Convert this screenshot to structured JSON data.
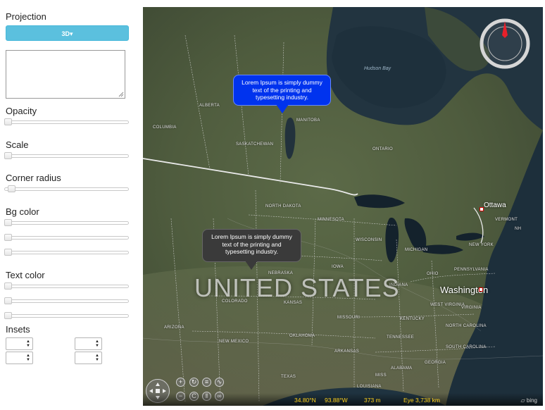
{
  "panel": {
    "projection_label": "Projection",
    "projection_value": "3D▾",
    "textarea_value": "",
    "opacity_label": "Opacity",
    "opacity_value": 0,
    "scale_label": "Scale",
    "scale_value": 0,
    "corner_radius_label": "Corner radius",
    "corner_radius_value": 0.03,
    "bg_color_label": "Bg color",
    "bg_color_values": [
      0,
      0,
      0
    ],
    "text_color_label": "Text color",
    "text_color_values": [
      0,
      0,
      0
    ],
    "insets_label": "Insets",
    "insets_values": [
      "",
      "",
      "",
      ""
    ]
  },
  "map": {
    "country_label": "UNITED STATES",
    "water_labels": {
      "hudson_bay": "Hudson Bay"
    },
    "region_labels": {
      "alberta": "ALBERTA",
      "columbia": "COLUMBIA",
      "saskatchewan": "SASKATCHEWAN",
      "manitoba": "MANITOBA",
      "ontario": "ONTARIO",
      "north_dakota": "NORTH DAKOTA",
      "minnesota": "MINNESOTA",
      "wisconsin": "WISCONSIN",
      "michigan": "MICHIGAN",
      "iowa": "IOWA",
      "nebraska": "NEBRASKA",
      "kansas": "KANSAS",
      "colorado": "COLORADO",
      "arizona": "ARIZONA",
      "new_mexico": "NEW MEXICO",
      "oklahoma": "OKLAHOMA",
      "texas": "TEXAS",
      "missouri": "MISSOURI",
      "arkansas": "ARKANSAS",
      "louisiana": "LOUISIANA",
      "alabama": "ALABAMA",
      "georgia": "GEORGIA",
      "kentucky": "KENTUCKY",
      "ohio": "OHIO",
      "indiana": "INDIANA",
      "pennsylvania": "PENNSYLVANIA",
      "new_york": "NEW YORK",
      "vermont": "VERMONT",
      "new_hampshire": "NH",
      "west_virginia": "WEST VIRGINIA",
      "virginia": "VIRGINIA",
      "north_carolina": "NORTH CAROLINA",
      "south_carolina": "SOUTH CAROLINA",
      "tennessee": "TENNESSEE",
      "mississippi": "MISS"
    },
    "cities": {
      "ottawa": "Ottawa",
      "washington": "Washington"
    },
    "callout_blue": {
      "text": "Lorem Ipsum is simply dummy text of the printing and typesetting industry.",
      "color": "#0033ee"
    },
    "callout_dark": {
      "text": "Lorem Ipsum is simply dummy text of the printing and typesetting industry.",
      "color": "#3a3a3a"
    },
    "status": {
      "latitude": "34.80°N",
      "longitude": "93.88°W",
      "altitude": "373 m",
      "eye": "Eye  3,738 km",
      "provider": "bing"
    },
    "colors": {
      "status_text": "#ffd21e",
      "projection_button": "#5bc0de"
    }
  }
}
